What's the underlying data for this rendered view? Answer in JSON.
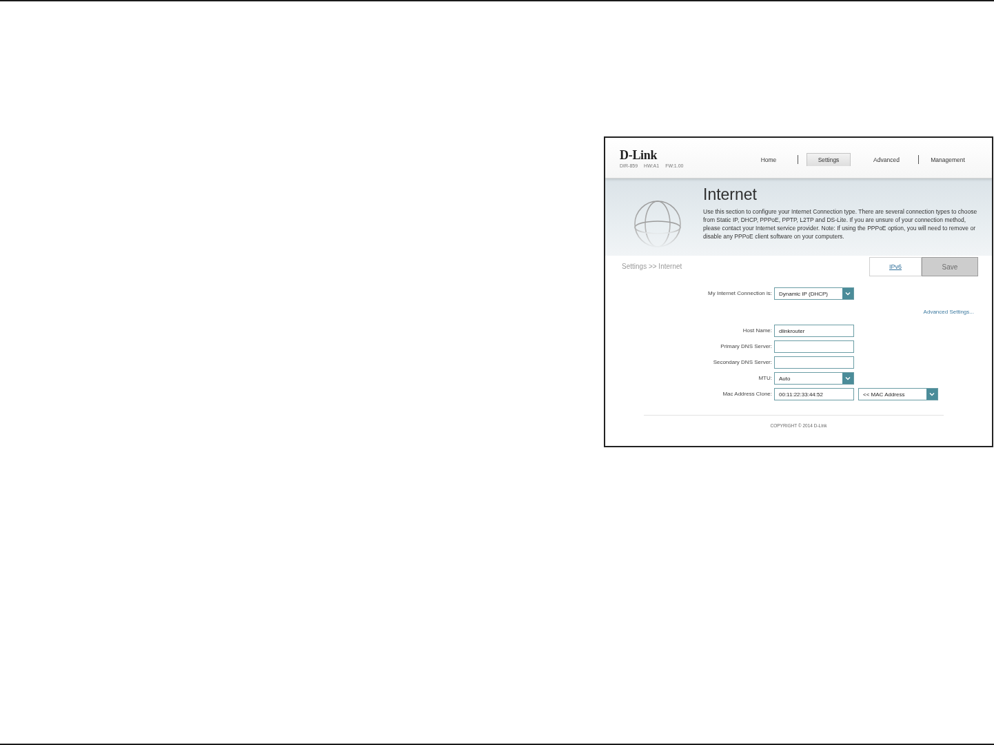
{
  "router_ui": {
    "logo": "D-Link",
    "device_info": [
      "DIR-859",
      "HW:A1",
      "FW:1.00"
    ],
    "nav": [
      {
        "label": "Home",
        "selected": false
      },
      {
        "label": "Settings",
        "selected": true
      },
      {
        "label": "Advanced",
        "selected": false
      },
      {
        "label": "Management",
        "selected": false
      }
    ],
    "banner": {
      "title": "Internet",
      "description": "Use this section to configure your Internet Connection type. There are several connection types to choose from Static IP, DHCP, PPPoE, PPTP, L2TP and DS-Lite. If you are unsure of your connection method, please contact your Internet service provider. Note: If using the PPPoE option, you will need to remove or disable any PPPoE client software on your computers."
    },
    "breadcrumb": "Settings >> Internet",
    "actions": [
      {
        "label": "IPv6",
        "kind": "link"
      },
      {
        "label": "Save",
        "kind": "button",
        "disabled": true
      }
    ],
    "connection": {
      "label": "My Internet Connection is:",
      "value": "Dynamic IP (DHCP)"
    },
    "advanced_link": "Advanced Settings...",
    "fields": [
      {
        "label": "Host Name:",
        "kind": "text",
        "value": "dlinkrouter"
      },
      {
        "label": "Primary DNS Server:",
        "kind": "text"
      },
      {
        "label": "Secondary DNS Server:",
        "kind": "text"
      },
      {
        "label": "MTU:",
        "kind": "select",
        "value": "Auto"
      },
      {
        "label": "Mac Address Clone:",
        "kind": "text",
        "value": "00:11:22:33:44:52",
        "clone_source": "<< MAC Address"
      }
    ],
    "copyright": "COPYRIGHT © 2014 D-Link"
  }
}
